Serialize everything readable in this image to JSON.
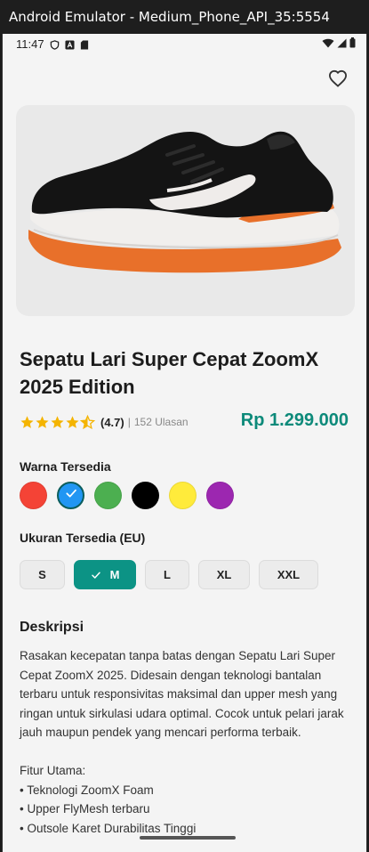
{
  "window": {
    "title": "Android Emulator - Medium_Phone_API_35:5554"
  },
  "status_bar": {
    "time": "11:47"
  },
  "product": {
    "title": "Sepatu Lari Super Cepat ZoomX 2025 Edition",
    "rating_value": "(4.7)",
    "rating_separator": "|",
    "review_count": "152 Ulasan",
    "rating": 4.7,
    "price": "Rp 1.299.000"
  },
  "colors": {
    "label": "Warna Tersedia",
    "options": [
      {
        "hex": "#f44336",
        "selected": false
      },
      {
        "hex": "#2196f3",
        "selected": true
      },
      {
        "hex": "#4caf50",
        "selected": false
      },
      {
        "hex": "#000000",
        "selected": false
      },
      {
        "hex": "#ffeb3b",
        "selected": false
      },
      {
        "hex": "#9c27b0",
        "selected": false
      }
    ]
  },
  "sizes": {
    "label": "Ukuran Tersedia (EU)",
    "options": [
      "S",
      "M",
      "L",
      "XL",
      "XXL"
    ],
    "selected": "M"
  },
  "description": {
    "title": "Deskripsi",
    "body": "Rasakan kecepatan tanpa batas dengan Sepatu Lari Super Cepat ZoomX 2025. Didesain dengan teknologi bantalan terbaru untuk responsivitas maksimal dan upper mesh yang ringan untuk sirkulasi udara optimal. Cocok untuk pelari jarak jauh maupun pendek yang mencari performa terbaik.\n\nFitur Utama:\n• Teknologi ZoomX Foam\n• Upper FlyMesh terbaru\n• Outsole Karet Durabilitas Tinggi"
  },
  "icons": {
    "favorite": "heart-outline-icon",
    "star": "star-icon",
    "check": "check-icon"
  },
  "accent_color": "#0c9385",
  "price_color": "#0d8a7a"
}
